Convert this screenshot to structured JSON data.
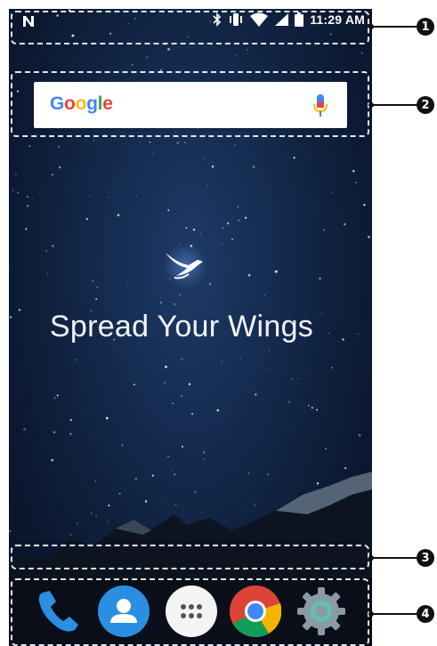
{
  "status_bar": {
    "time": "11:29 AM",
    "icons": [
      "n-icon",
      "bluetooth-icon",
      "vibrate-icon",
      "wifi-icon",
      "cellular-signal-icon",
      "battery-icon"
    ]
  },
  "search": {
    "logo_text": [
      "G",
      "o",
      "o",
      "g",
      "l",
      "e"
    ],
    "logo_colors": [
      "#4285F4",
      "#EA4335",
      "#FBBC05",
      "#4285F4",
      "#34A853",
      "#EA4335"
    ]
  },
  "wallpaper": {
    "slogan": "Spread Your Wings"
  },
  "dock": {
    "apps": [
      "phone-icon",
      "contacts-icon",
      "app-drawer-icon",
      "chrome-icon",
      "settings-icon"
    ]
  },
  "callouts": [
    "1",
    "2",
    "3",
    "4"
  ]
}
